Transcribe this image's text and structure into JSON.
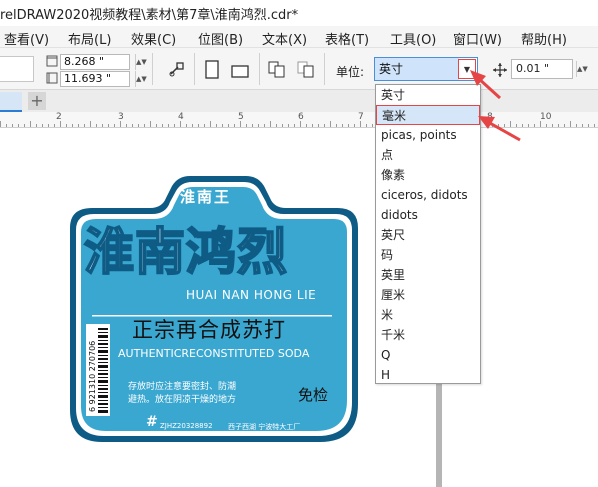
{
  "window": {
    "title": "relDRAW2020视频教程\\素材\\第7章\\淮南鸿烈.cdr*"
  },
  "menubar": {
    "items": [
      "查看(V)",
      "布局(L)",
      "效果(C)",
      "位图(B)",
      "文本(X)",
      "表格(T)",
      "工具(O)",
      "窗口(W)",
      "帮助(H)"
    ]
  },
  "propbar": {
    "width_value": "8.268 \"",
    "height_value": "11.693 \"",
    "units_label": "单位:",
    "units_selected": "英寸",
    "nudge_value": "0.01 \""
  },
  "ruler": {
    "labels": [
      "2",
      "3",
      "4",
      "5",
      "6",
      "7",
      "8",
      "10"
    ]
  },
  "units_dropdown": {
    "options": [
      "英寸",
      "毫米",
      "picas, points",
      "点",
      "像素",
      "ciceros, didots",
      "didots",
      "英尺",
      "码",
      "英里",
      "厘米",
      "米",
      "千米",
      "Q",
      "H"
    ],
    "highlighted": "毫米"
  },
  "label": {
    "brand_small": "淮南王",
    "title": "淮南鸿烈",
    "pinyin": "HUAI NAN HONG LIE",
    "subtitle": "正宗再合成苏打",
    "english": "AUTHENTICRECONSTITUTED SODA",
    "barcode_number": "6 921310 270706",
    "storage_line1": "存放时应注意要密封、防潮",
    "storage_line2": "避热。放在阴凉干燥的地方",
    "inspection": "免检",
    "bottom_text": "ZJHZ20328892",
    "bottom_company": "西子西湖  宁波特大工厂",
    "hash_mark": "#"
  },
  "colors": {
    "label_blue": "#3aa7d0",
    "label_dark_blue": "#0e5c85",
    "selection_blue": "#cfe4fa",
    "arrow_red": "#e64545"
  }
}
